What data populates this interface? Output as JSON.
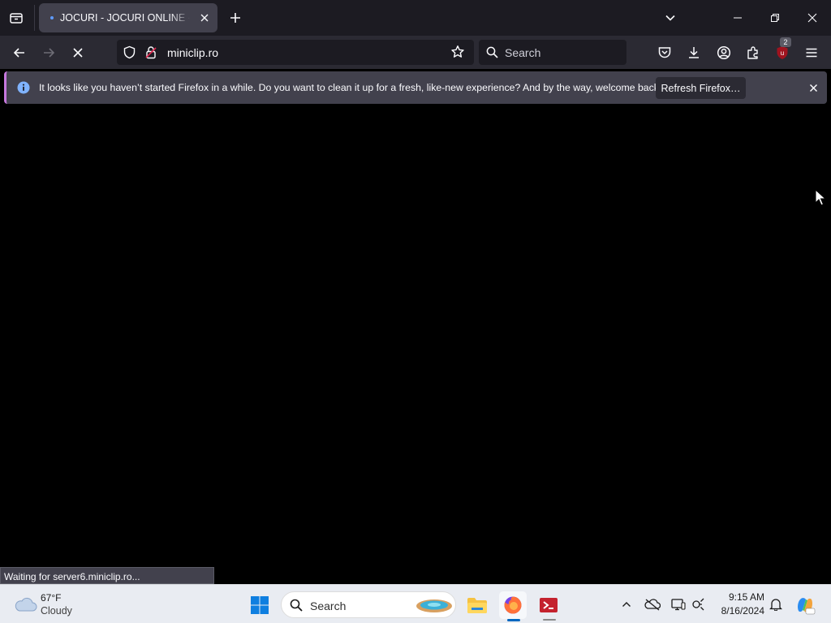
{
  "browser": {
    "tab": {
      "title": "JOCURI - JOCURI ONLINE - WWW.MINICLIP.RO"
    },
    "url": "miniclip.ro",
    "search_placeholder": "Search",
    "extension_badge": "2"
  },
  "notification": {
    "message": "It looks like you haven’t started Firefox in a while. Do you want to clean it up for a fresh, like-new experience? And by the way, welcome back!",
    "button_label": "Refresh Firefox…"
  },
  "status_text": "Waiting for server6.miniclip.ro...",
  "taskbar": {
    "weather_temp": "67°F",
    "weather_condition": "Cloudy",
    "search_placeholder": "Search",
    "clock_time": "9:15 AM",
    "clock_date": "8/16/2024"
  },
  "icons": [
    "tab-list-icon",
    "close-icon",
    "plus-icon",
    "chevron-down-icon",
    "minimize-icon",
    "restore-icon",
    "back-arrow-icon",
    "forward-arrow-icon",
    "stop-loading-icon",
    "shield-icon",
    "lock-icon",
    "star-icon",
    "search-icon",
    "pocket-icon",
    "download-icon",
    "account-icon",
    "extensions-icon",
    "ublock-icon",
    "menu-icon",
    "info-icon",
    "cloud-icon",
    "windows-start-icon",
    "file-explorer-icon",
    "firefox-icon",
    "terminal-app-icon",
    "chevron-up-icon",
    "onedrive-icon",
    "display-icon",
    "network-icon",
    "bell-icon",
    "copilot-icon"
  ],
  "colors": {
    "accent": "#0067c0",
    "notification_border": "#c678dd",
    "ublock_red": "#a0131f"
  }
}
